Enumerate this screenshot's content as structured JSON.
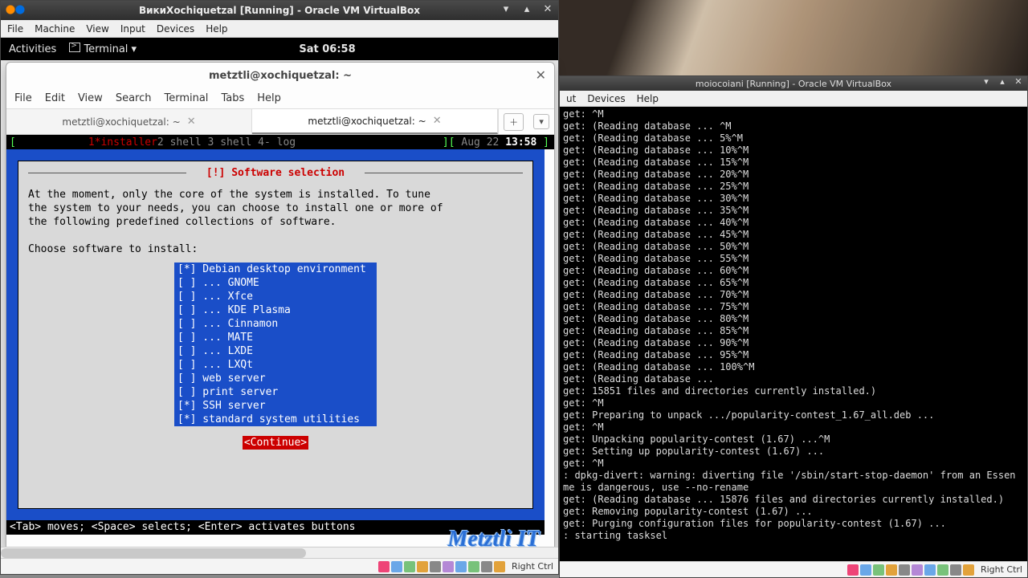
{
  "left": {
    "window_title": "ВикиXochiquetzal [Running] - Oracle VM VirtualBox",
    "vb_menu": [
      "File",
      "Machine",
      "View",
      "Input",
      "Devices",
      "Help"
    ],
    "gnome": {
      "activities": "Activities",
      "app": "Terminal ▾",
      "clock": "Sat 06:58"
    },
    "term": {
      "title": "metztli@xochiquetzal: ~",
      "menu": [
        "File",
        "Edit",
        "View",
        "Search",
        "Terminal",
        "Tabs",
        "Help"
      ],
      "tabs": [
        "metztli@xochiquetzal: ~",
        "metztli@xochiquetzal: ~"
      ],
      "active_tab": 1,
      "screen_bar": {
        "left_bracket": "[",
        "session": "1*installer",
        "others": "  2 shell  3 shell  4- log",
        "right_bracket": "][",
        "date": " Aug 22 ",
        "time": "13:58",
        "end": " ]"
      },
      "dialog": {
        "title": "[!] Software selection",
        "text": "At the moment, only the core of the system is installed. To tune\nthe system to your needs, you can choose to install one or more of\nthe following predefined collections of software.\n\nChoose software to install:",
        "options": [
          {
            "mark": "*",
            "label": "Debian desktop environment"
          },
          {
            "mark": " ",
            "label": "... GNOME"
          },
          {
            "mark": " ",
            "label": "... Xfce"
          },
          {
            "mark": " ",
            "label": "... KDE Plasma"
          },
          {
            "mark": " ",
            "label": "... Cinnamon"
          },
          {
            "mark": " ",
            "label": "... MATE"
          },
          {
            "mark": " ",
            "label": "... LXDE"
          },
          {
            "mark": " ",
            "label": "... LXQt"
          },
          {
            "mark": " ",
            "label": "web server"
          },
          {
            "mark": " ",
            "label": "print server"
          },
          {
            "mark": "*",
            "label": "SSH server"
          },
          {
            "mark": "*",
            "label": "standard system utilities"
          }
        ],
        "continue": "<Continue>"
      },
      "help_line": "<Tab> moves; <Space> selects; <Enter> activates buttons",
      "watermark": "Metztli IT"
    },
    "statusbar": {
      "host_key": "Right Ctrl"
    }
  },
  "right": {
    "window_title": "moiocoiani [Running] - Oracle VM VirtualBox",
    "vb_menu_tail": [
      "ut",
      "Devices",
      "Help"
    ],
    "log_lines": [
      "get: ^M",
      "get: (Reading database ... ^M",
      "get: (Reading database ... 5%^M",
      "get: (Reading database ... 10%^M",
      "get: (Reading database ... 15%^M",
      "get: (Reading database ... 20%^M",
      "get: (Reading database ... 25%^M",
      "get: (Reading database ... 30%^M",
      "get: (Reading database ... 35%^M",
      "get: (Reading database ... 40%^M",
      "get: (Reading database ... 45%^M",
      "get: (Reading database ... 50%^M",
      "get: (Reading database ... 55%^M",
      "get: (Reading database ... 60%^M",
      "get: (Reading database ... 65%^M",
      "get: (Reading database ... 70%^M",
      "get: (Reading database ... 75%^M",
      "get: (Reading database ... 80%^M",
      "get: (Reading database ... 85%^M",
      "get: (Reading database ... 90%^M",
      "get: (Reading database ... 95%^M",
      "get: (Reading database ... 100%^M",
      "get: (Reading database ... ",
      "get: 15851 files and directories currently installed.)",
      "get: ^M",
      "get: Preparing to unpack .../popularity-contest_1.67_all.deb ...",
      "get: ^M",
      "get: Unpacking popularity-contest (1.67) ...^M",
      "get: Setting up popularity-contest (1.67) ...",
      "get: ^M",
      ": dpkg-divert: warning: diverting file '/sbin/start-stop-daemon' from an Essen",
      "me is dangerous, use --no-rename",
      "get: (Reading database ... 15876 files and directories currently installed.)",
      "get: Removing popularity-contest (1.67) ...",
      "get: Purging configuration files for popularity-contest (1.67) ...",
      ": starting tasksel"
    ],
    "statusbar": {
      "host_key": "Right Ctrl"
    }
  }
}
